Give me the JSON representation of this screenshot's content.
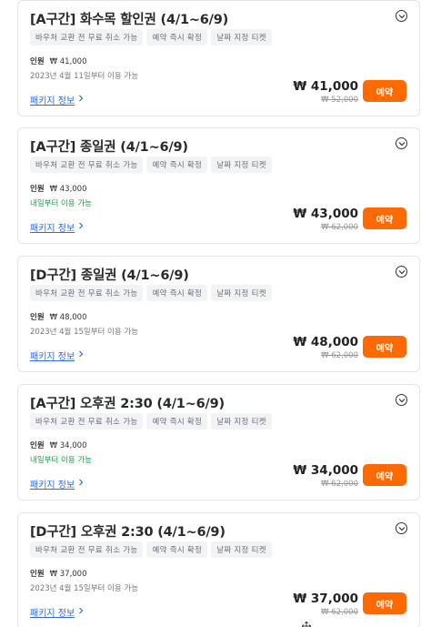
{
  "products": [
    {
      "title": "[A구간] 화수목 할인권 (4/1~6/9)",
      "tags": [
        "바우처 교환 전 무료 취소 가능",
        "예약 즉시 확정",
        "날짜 지정 티켓"
      ],
      "people_label": "인원",
      "people_price": "₩ 41,000",
      "availability": "2023년 4월 11일부터 이용 가능",
      "availability_style": "gray",
      "package_link": "패키지 정보",
      "price": "₩ 41,000",
      "original_price": "₩ 52,000",
      "book_label": "예약"
    },
    {
      "title": "[A구간] 종일권 (4/1~6/9)",
      "tags": [
        "바우처 교환 전 무료 취소 가능",
        "예약 즉시 확정",
        "날짜 지정 티켓"
      ],
      "people_label": "인원",
      "people_price": "₩ 43,000",
      "availability": "내일부터 이용 가능",
      "availability_style": "green",
      "package_link": "패키지 정보",
      "price": "₩ 43,000",
      "original_price": "₩ 62,000",
      "book_label": "예약"
    },
    {
      "title": "[D구간] 종일권 (4/1~6/9)",
      "tags": [
        "바우처 교환 전 무료 취소 가능",
        "예약 즉시 확정",
        "날짜 지정 티켓"
      ],
      "people_label": "인원",
      "people_price": "₩ 48,000",
      "availability": "2023년 4월 15일부터 이용 가능",
      "availability_style": "gray",
      "package_link": "패키지 정보",
      "price": "₩ 48,000",
      "original_price": "₩ 62,000",
      "book_label": "예약"
    },
    {
      "title": "[A구간] 오후권 2:30 (4/1~6/9)",
      "tags": [
        "바우처 교환 전 무료 취소 가능",
        "예약 즉시 확정",
        "날짜 지정 티켓"
      ],
      "people_label": "인원",
      "people_price": "₩ 34,000",
      "availability": "내일부터 이용 가능",
      "availability_style": "green",
      "package_link": "패키지 정보",
      "price": "₩ 34,000",
      "original_price": "₩ 62,000",
      "book_label": "예약"
    },
    {
      "title": "[D구간] 오후권 2:30 (4/1~6/9)",
      "tags": [
        "바우처 교환 전 무료 취소 가능",
        "예약 즉시 확정",
        "날짜 지정 티켓"
      ],
      "people_label": "인원",
      "people_price": "₩ 37,000",
      "availability": "2023년 4월 15일부터 이용 가능",
      "availability_style": "gray",
      "package_link": "패키지 정보",
      "price": "₩ 37,000",
      "original_price": "₩ 62,000",
      "book_label": "예약"
    }
  ],
  "colors": {
    "accent": "#ff6a00",
    "link": "#2f6bdc",
    "available_green": "#1a9c4a"
  },
  "icons": {
    "expand": "chevron-down-icon",
    "link_arrow": "chevron-right-icon",
    "cursor": "move-cursor-icon"
  }
}
